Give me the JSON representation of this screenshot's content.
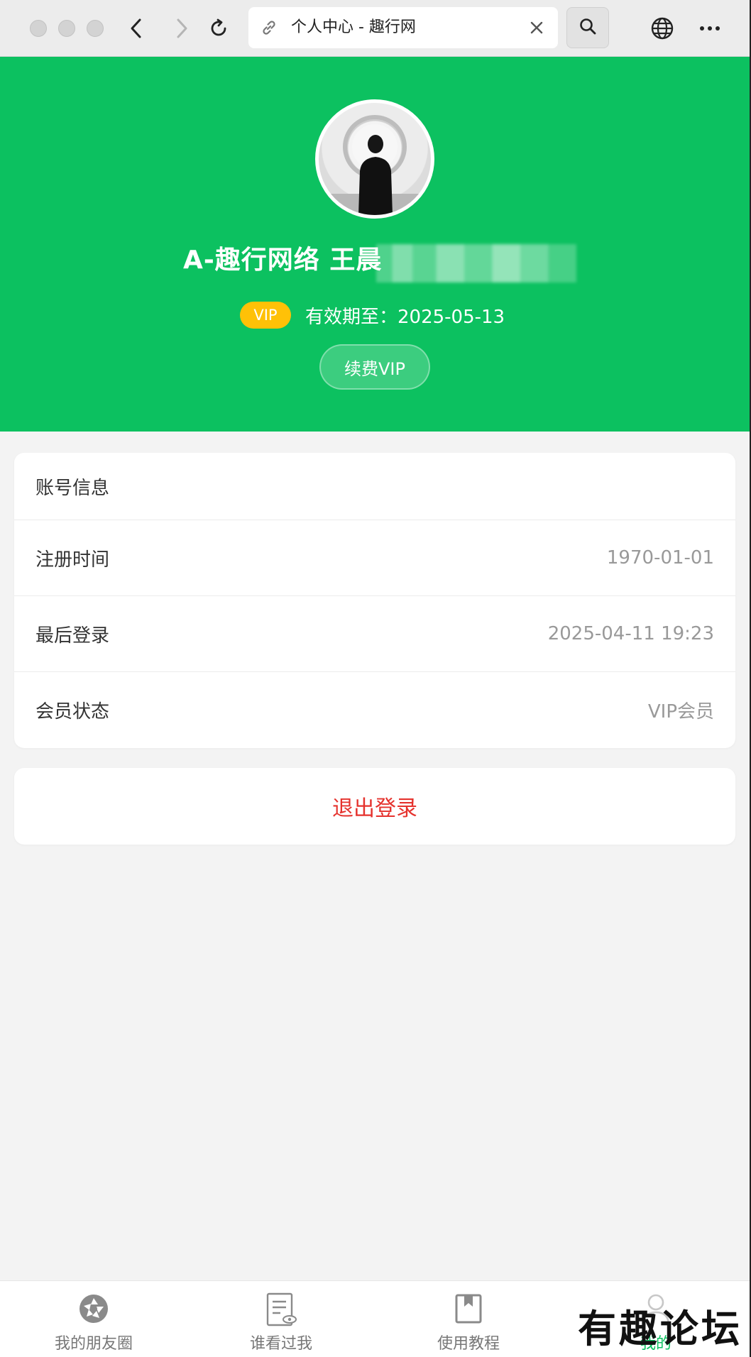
{
  "browser": {
    "tab_title": "个人中心 - 趣行网"
  },
  "profile": {
    "name": "A-趣行网络 王晨",
    "vip_badge": "VIP",
    "vip_expire": "有效期至：2025-05-13",
    "renew_label": "续费VIP"
  },
  "account": {
    "section_title": "账号信息",
    "rows": [
      {
        "label": "注册时间",
        "value": "1970-01-01"
      },
      {
        "label": "最后登录",
        "value": "2025-04-11 19:23"
      },
      {
        "label": "会员状态",
        "value": "VIP会员"
      }
    ]
  },
  "logout_label": "退出登录",
  "tabs": [
    {
      "label": "我的朋友圈",
      "icon": "aperture-icon"
    },
    {
      "label": "谁看过我",
      "icon": "document-eye-icon"
    },
    {
      "label": "使用教程",
      "icon": "bookmark-book-icon"
    },
    {
      "label": "我的",
      "icon": "user-icon",
      "active": true
    }
  ],
  "watermark": "有趣论坛",
  "colors": {
    "primary_green": "#0cc160",
    "vip_yellow": "#ffc107",
    "logout_red": "#e5322d"
  }
}
